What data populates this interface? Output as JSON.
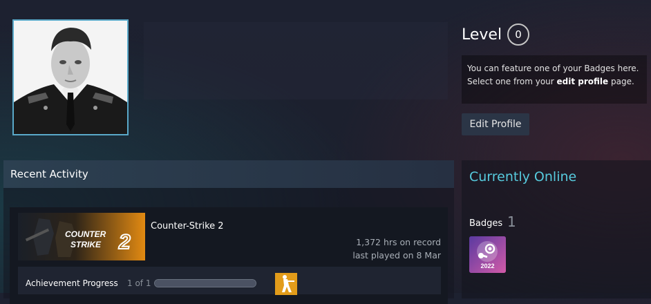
{
  "level": {
    "label": "Level",
    "value": "0"
  },
  "feature_box": {
    "line1": "You can feature one of your Badges here.",
    "line2_pre": "Select one from your ",
    "line2_link": "edit profile",
    "line2_post": " page."
  },
  "edit_profile": {
    "label": "Edit Profile"
  },
  "recent_activity": {
    "title": "Recent Activity",
    "game": {
      "name": "Counter-Strike 2",
      "capsule_text": [
        "COUNTER",
        "STRIKE",
        "2"
      ],
      "hours": "1,372 hrs on record",
      "last_played": "last played on 8 Mar",
      "achievement": {
        "label": "Achievement Progress",
        "count": "1 of 1",
        "progress": 1.0
      }
    }
  },
  "online": {
    "status": "Currently Online",
    "badges_label": "Badges",
    "badges_count": "1",
    "badge_year": "2022"
  },
  "colors": {
    "online_accent": "#57cbde",
    "avatar_border": "#5aa9c9",
    "cs2_orange": "#e28a12"
  }
}
